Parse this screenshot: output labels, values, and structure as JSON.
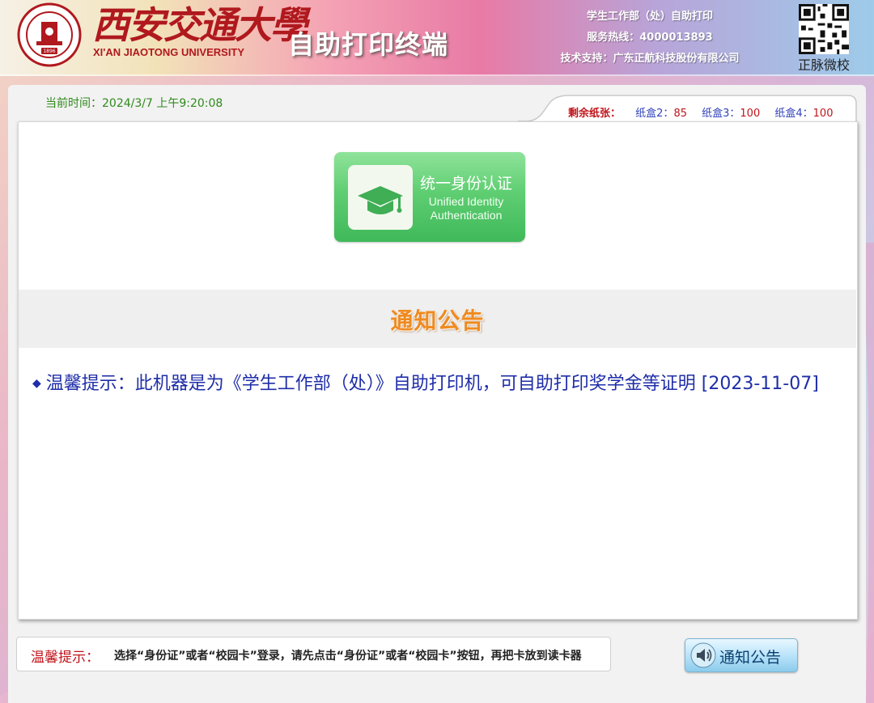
{
  "header": {
    "logo_cn": "西安交通大學",
    "logo_en": "XI'AN JIAOTONG UNIVERSITY",
    "seal_year": "1896",
    "terminal_title": "自助打印终端",
    "info_lines": [
      "学生工作部（处）自助打印",
      "服务热线：4000013893",
      "技术支持：广东正航科技股份有限公司"
    ],
    "qr_label": "正脉微校"
  },
  "status": {
    "current_time": "当前时间：2024/3/7 上午9:20:08",
    "paper_label": "剩余纸张：",
    "trays": [
      {
        "name": "纸盒2：",
        "count": "85"
      },
      {
        "name": "纸盒3：",
        "count": "100"
      },
      {
        "name": "纸盒4：",
        "count": "100"
      }
    ]
  },
  "auth_button": {
    "label_cn": "统一身份认证",
    "label_en_1": "Unified Identity",
    "label_en_2": "Authentication",
    "icon": "graduation-cap-icon"
  },
  "notice": {
    "title": "通知公告",
    "items": [
      {
        "text": "温馨提示：此机器是为《学生工作部（处）》自助打印机，可自助打印奖学金等证明 [2023-11-07]"
      }
    ]
  },
  "footer": {
    "marquee_label": "温馨提示：",
    "marquee_text": "选择“身份证”或者“校园卡”登录，请先点击“身份证”或者“校园卡”按钮，再把卡放到读卡器",
    "notice_button_label": "通知公告",
    "notice_button_icon": "speaker-icon"
  },
  "colors": {
    "brand_red": "#b0191e",
    "auth_green": "#5fce72",
    "notice_orange": "#f08a1e",
    "text_blue": "#1f2ea8"
  }
}
